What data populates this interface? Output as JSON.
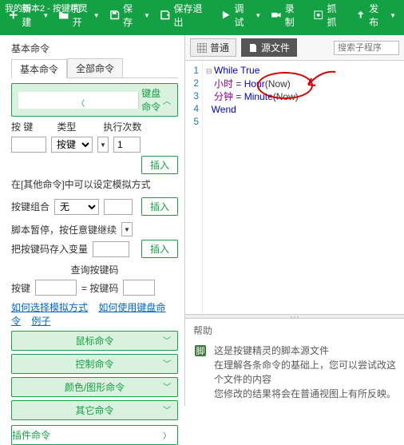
{
  "window_title": "我的脚本2 - 按键精灵",
  "toolbar": {
    "new": "新建",
    "open": "打开",
    "save": "保存",
    "save_exit": "保存退出",
    "debug": "调试",
    "record": "录制",
    "capture": "抓抓",
    "publish": "发布"
  },
  "left": {
    "section_title": "基本命令",
    "tabs": {
      "basic": "基本命令",
      "all": "全部命令"
    },
    "group_keyboard": "键盘命令",
    "labels": {
      "key": "按  键",
      "type": "类型",
      "count": "执行次数"
    },
    "type_value": "按键",
    "count_value": "1",
    "insert": "插入",
    "note1": "在[其他命令]中可以设定模拟方式",
    "combo_label": "按键组合",
    "combo_value": "无",
    "pause_label": "脚本暂停，按任意键继续",
    "store_label": "把按键码存入变量",
    "query_label": "查询按键码",
    "query_key": "按键",
    "equals": "= 按键码",
    "links": {
      "sim": "如何选择模拟方式",
      "kb": "如何使用键盘命令",
      "ex": "例子"
    },
    "bars": {
      "mouse": "鼠标命令",
      "control": "控制命令",
      "color": "颜色/图形命令",
      "other": "其它命令",
      "plugin": "插件命令"
    }
  },
  "right": {
    "tab_normal": "普通",
    "tab_source": "源文件",
    "search_placeholder": "搜索子程序",
    "code": {
      "l1a": "While",
      "l1b": " True",
      "l2a": "小时",
      "l2b": " = ",
      "l2c": "Hour",
      "l2d": "(Now)",
      "l3a": "分钟",
      "l3b": " = ",
      "l3c": "Minute",
      "l3d": "(Now)",
      "l4": "Wend"
    },
    "line_nos": [
      "1",
      "2",
      "3",
      "4",
      "5"
    ]
  },
  "help": {
    "title": "帮助",
    "line1": "这是按键精灵的脚本源文件",
    "line2": "在理解各条命令的基础上，您可以尝试改这个文件的内容",
    "line3": "您修改的结果将会在普通视图上有所反映。"
  }
}
